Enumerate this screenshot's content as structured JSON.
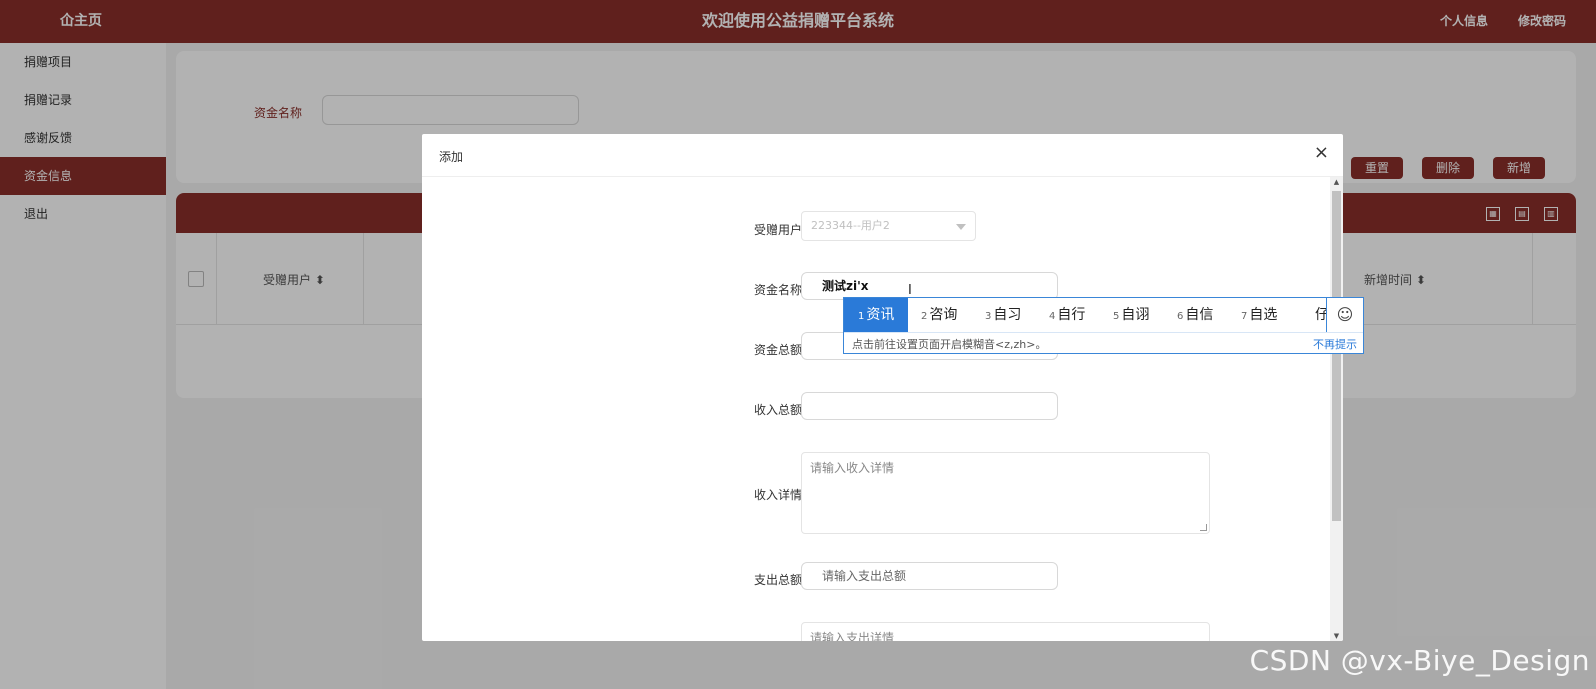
{
  "header": {
    "home_label": "仚主页",
    "title": "欢迎使用公益捐赠平台系统",
    "profile_link": "个人信息",
    "password_link": "修改密码"
  },
  "sidebar": {
    "items": [
      {
        "label": "捐赠项目"
      },
      {
        "label": "捐赠记录"
      },
      {
        "label": "感谢反馈"
      },
      {
        "label": "资金信息"
      },
      {
        "label": "退出"
      }
    ]
  },
  "search": {
    "label": "资金名称",
    "value": ""
  },
  "buttons": {
    "reset": "重置",
    "delete": "删除",
    "add": "新增"
  },
  "table": {
    "columns": [
      "受赠用户",
      "新增时间"
    ]
  },
  "dialog": {
    "title": "添加",
    "close": "×",
    "fields": {
      "recipient_label": "受赠用户",
      "recipient_value": "223344--用户2",
      "fund_name_label": "资金名称",
      "fund_name_value": "测试zi'x",
      "fund_total_label": "资金总额",
      "income_total_label": "收入总额",
      "income_detail_label": "收入详情",
      "income_detail_placeholder": "请输入收入详情",
      "expense_total_label": "支出总额",
      "expense_total_placeholder": "请输入支出总额",
      "expense_detail_placeholder": "请输入支出详情"
    }
  },
  "ime": {
    "candidates": [
      {
        "num": "1",
        "text": "资讯"
      },
      {
        "num": "2",
        "text": "咨询"
      },
      {
        "num": "3",
        "text": "自习"
      },
      {
        "num": "4",
        "text": "自行"
      },
      {
        "num": "5",
        "text": "自诩"
      },
      {
        "num": "6",
        "text": "自信"
      },
      {
        "num": "7",
        "text": "自选"
      },
      {
        "num": "",
        "text": "仔"
      }
    ],
    "emoji": "☺",
    "hint": "点击前往设置页面开启模糊音<z,zh>。",
    "dismiss": "不再提示"
  },
  "watermark": "CSDN @vx-Biye_Design"
}
